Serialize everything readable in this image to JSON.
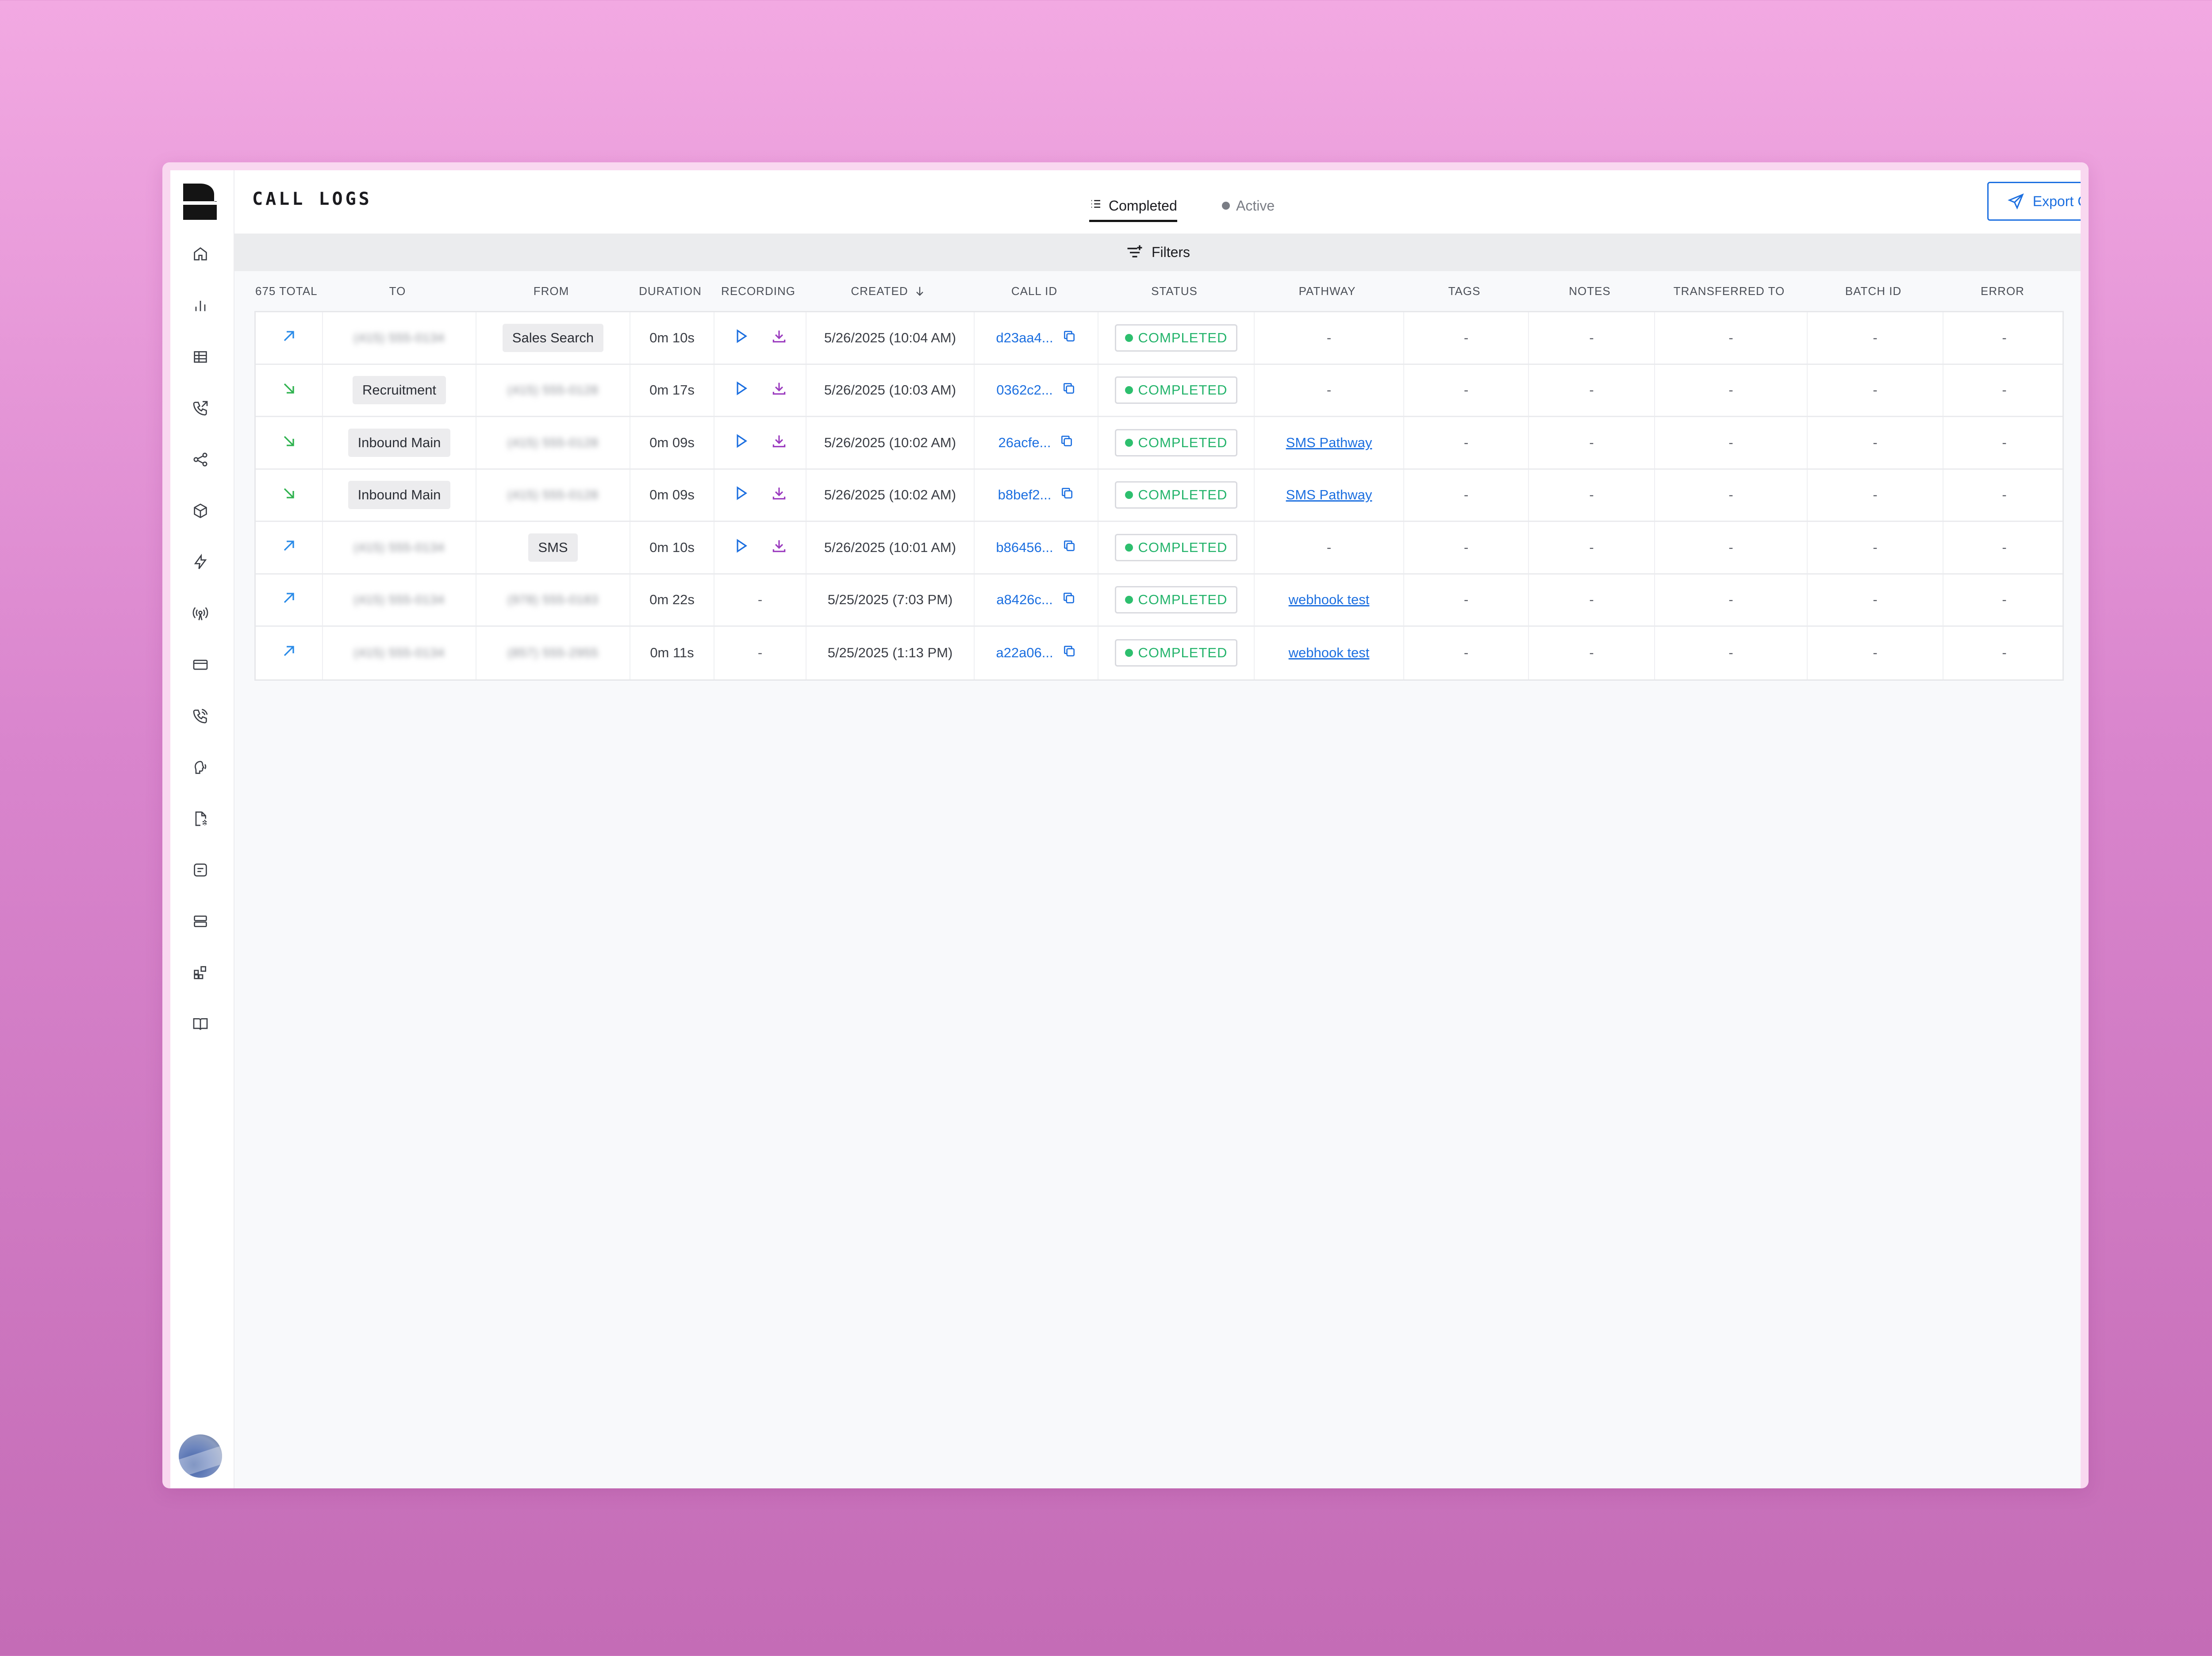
{
  "header": {
    "title": "CALL LOGS",
    "tabs": [
      {
        "label": "Completed",
        "active": true
      },
      {
        "label": "Active",
        "active": false
      }
    ],
    "export_label": "Export Calls"
  },
  "filters": {
    "label": "Filters"
  },
  "sidebar": {
    "icons": [
      "home-icon",
      "bar-chart-icon",
      "table-icon",
      "phone-outgoing-icon",
      "share-nodes-icon",
      "cube-icon",
      "lightning-icon",
      "broadcast-icon",
      "credit-card-icon",
      "phone-call-icon",
      "voice-icon",
      "document-scan-icon",
      "message-square-icon",
      "server-icon",
      "widgets-icon",
      "book-icon"
    ]
  },
  "table": {
    "headers": {
      "total": "675 TOTAL",
      "to": "TO",
      "from": "FROM",
      "duration": "DURATION",
      "recording": "RECORDING",
      "created": "CREATED",
      "call_id": "CALL ID",
      "status": "STATUS",
      "pathway": "PATHWAY",
      "tags": "TAGS",
      "notes": "NOTES",
      "transferred_to": "TRANSFERRED TO",
      "batch_id": "BATCH ID",
      "error": "ERROR"
    },
    "rows": [
      {
        "direction": "outbound",
        "to": "(415) 555-0134",
        "to_pill": false,
        "from": "Sales Search",
        "from_pill": true,
        "duration": "0m 10s",
        "recording": true,
        "created": "5/26/2025 (10:04 AM)",
        "call_id": "d23aa4...",
        "status": "COMPLETED",
        "pathway": "-",
        "pathway_link": false,
        "tags": "-",
        "notes": "-",
        "transferred_to": "-",
        "batch_id": "-",
        "error": "-"
      },
      {
        "direction": "inbound",
        "to": "Recruitment",
        "to_pill": true,
        "from": "(415) 555-0128",
        "from_pill": false,
        "duration": "0m 17s",
        "recording": true,
        "created": "5/26/2025 (10:03 AM)",
        "call_id": "0362c2...",
        "status": "COMPLETED",
        "pathway": "-",
        "pathway_link": false,
        "tags": "-",
        "notes": "-",
        "transferred_to": "-",
        "batch_id": "-",
        "error": "-"
      },
      {
        "direction": "inbound",
        "to": "Inbound Main",
        "to_pill": true,
        "from": "(415) 555-0128",
        "from_pill": false,
        "duration": "0m 09s",
        "recording": true,
        "created": "5/26/2025 (10:02 AM)",
        "call_id": "26acfe...",
        "status": "COMPLETED",
        "pathway": "SMS Pathway",
        "pathway_link": true,
        "tags": "-",
        "notes": "-",
        "transferred_to": "-",
        "batch_id": "-",
        "error": "-"
      },
      {
        "direction": "inbound",
        "to": "Inbound Main",
        "to_pill": true,
        "from": "(415) 555-0128",
        "from_pill": false,
        "duration": "0m 09s",
        "recording": true,
        "created": "5/26/2025 (10:02 AM)",
        "call_id": "b8bef2...",
        "status": "COMPLETED",
        "pathway": "SMS Pathway",
        "pathway_link": true,
        "tags": "-",
        "notes": "-",
        "transferred_to": "-",
        "batch_id": "-",
        "error": "-"
      },
      {
        "direction": "outbound",
        "to": "(415) 555-0134",
        "to_pill": false,
        "from": "SMS",
        "from_pill": true,
        "duration": "0m 10s",
        "recording": true,
        "created": "5/26/2025 (10:01 AM)",
        "call_id": "b86456...",
        "status": "COMPLETED",
        "pathway": "-",
        "pathway_link": false,
        "tags": "-",
        "notes": "-",
        "transferred_to": "-",
        "batch_id": "-",
        "error": "-"
      },
      {
        "direction": "outbound",
        "to": "(415) 555-0134",
        "to_pill": false,
        "from": "(978) 555-0183",
        "from_pill": false,
        "duration": "0m 22s",
        "recording": false,
        "created": "5/25/2025 (7:03 PM)",
        "call_id": "a8426c...",
        "status": "COMPLETED",
        "pathway": "webhook test",
        "pathway_link": true,
        "tags": "-",
        "notes": "-",
        "transferred_to": "-",
        "batch_id": "-",
        "error": "-"
      },
      {
        "direction": "outbound",
        "to": "(415) 555-0134",
        "to_pill": false,
        "from": "(857) 555-2955",
        "from_pill": false,
        "duration": "0m 11s",
        "recording": false,
        "created": "5/25/2025 (1:13 PM)",
        "call_id": "a22a06...",
        "status": "COMPLETED",
        "pathway": "webhook test",
        "pathway_link": true,
        "tags": "-",
        "notes": "-",
        "transferred_to": "-",
        "batch_id": "-",
        "error": "-"
      }
    ],
    "recording_placeholder": "-"
  },
  "colors": {
    "accent": "#1c6fe0",
    "completed": "#22b36a",
    "outbound_arrow": "#2a8be8",
    "inbound_arrow": "#2fb24f",
    "download": "#9b3bbf"
  }
}
